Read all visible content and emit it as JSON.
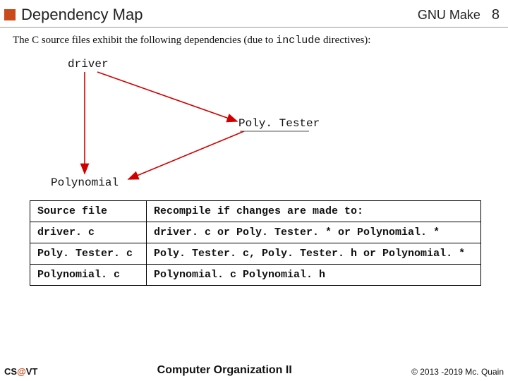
{
  "header": {
    "title": "Dependency Map",
    "right": "GNU Make",
    "page": "8"
  },
  "intro": {
    "prefix": "The C source files exhibit the following dependencies (due to ",
    "mono": "include",
    "suffix": " directives):"
  },
  "nodes": {
    "driver": "driver",
    "polytester": "Poly. Tester",
    "polynomial": "Polynomial"
  },
  "table": {
    "header": {
      "c1": "Source file",
      "c2": "Recompile if changes are made to:"
    },
    "rows": [
      {
        "c1": "driver. c",
        "c2": "driver. c or Poly. Tester. * or Polynomial. *"
      },
      {
        "c1": "Poly. Tester. c",
        "c2": "Poly. Tester. c,  Poly. Tester. h or Polynomial. *"
      },
      {
        "c1": "Polynomial. c",
        "c2": "Polynomial. c Polynomial. h"
      }
    ]
  },
  "footer": {
    "left_cs": "CS",
    "left_at": "@",
    "left_vt": "VT",
    "center": "Computer Organization II",
    "right": "© 2013 -2019 Mc. Quain"
  }
}
